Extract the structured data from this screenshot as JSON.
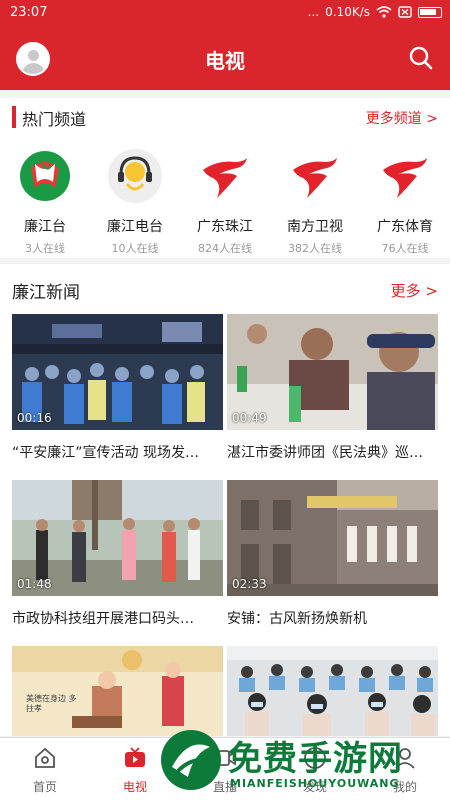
{
  "status": {
    "time": "23:07",
    "signal": "...",
    "speed": "0.10K/s"
  },
  "header": {
    "title": "电视"
  },
  "hot": {
    "title": "热门频道",
    "more": "更多频道 >",
    "channels": [
      {
        "name": "廉江台",
        "count": "3人在线"
      },
      {
        "name": "廉江电台",
        "count": "10人在线"
      },
      {
        "name": "广东珠江",
        "count": "824人在线"
      },
      {
        "name": "南方卫视",
        "count": "382人在线"
      },
      {
        "name": "广东体育",
        "count": "76人在线"
      }
    ]
  },
  "news": {
    "title": "廉江新闻",
    "more": "更多 >",
    "items": [
      {
        "duration": "00:16",
        "caption": "“平安廉江”宣传活动 现场发…"
      },
      {
        "duration": "00:49",
        "caption": "湛江市委讲师团《民法典》巡…"
      },
      {
        "duration": "01:48",
        "caption": "市政协科技组开展港口码头…"
      },
      {
        "duration": "02:33",
        "caption": "安铺：古风新扬焕新机"
      },
      {
        "duration": "",
        "caption": ""
      },
      {
        "duration": "",
        "caption": ""
      }
    ],
    "thumb_art_text": "美德在身边 多拄孝"
  },
  "tabs": [
    {
      "label": "首页",
      "icon": "home-icon",
      "active": false
    },
    {
      "label": "电视",
      "icon": "tv-icon",
      "active": true
    },
    {
      "label": "直播",
      "icon": "live-icon",
      "active": false
    },
    {
      "label": "发现",
      "icon": "compass-icon",
      "active": false
    },
    {
      "label": "我的",
      "icon": "user-icon",
      "active": false
    }
  ],
  "watermark": {
    "title": "免费手游网",
    "subtitle": "MIANFEISHOUYOUWANG"
  },
  "colors": {
    "brand_red": "#d9262c",
    "bg": "#f3f3f3"
  }
}
